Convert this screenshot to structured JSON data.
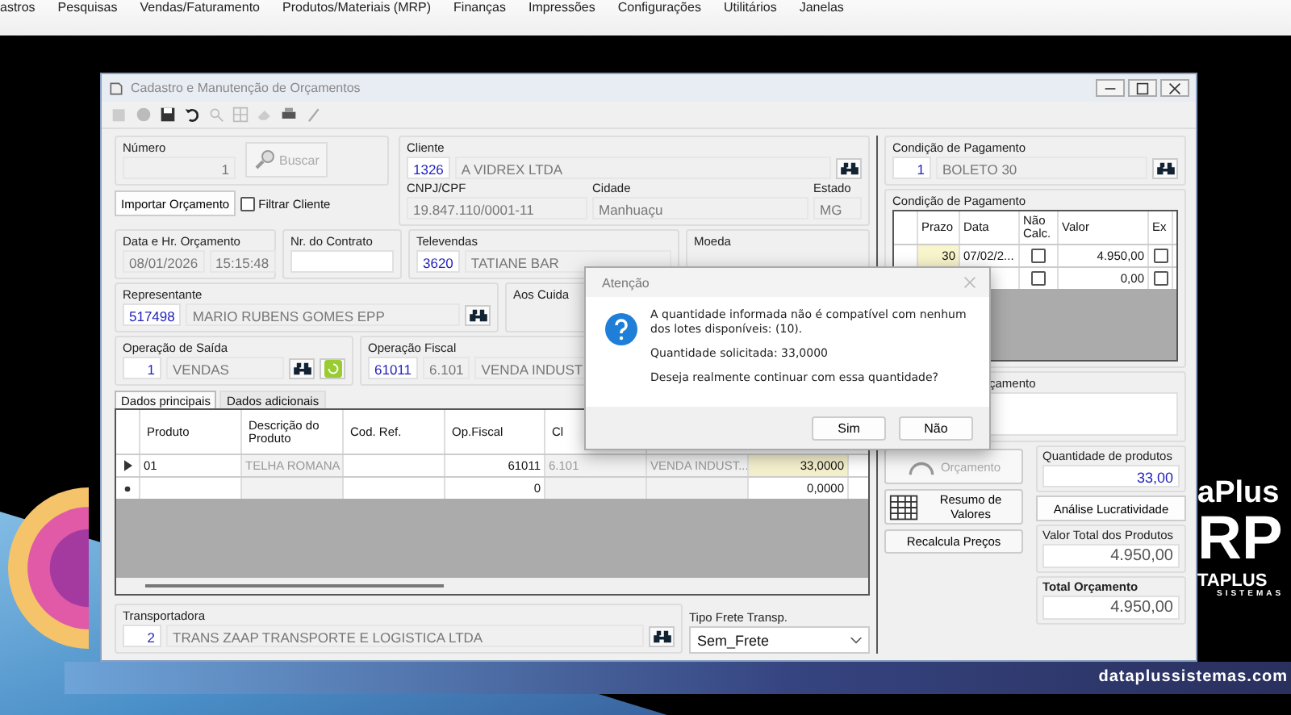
{
  "menu": [
    {
      "label": "astros"
    },
    {
      "label": "Pesquisas"
    },
    {
      "label": "Vendas/Faturamento"
    },
    {
      "label": "Produtos/Materiais (MRP)"
    },
    {
      "label": "Finanças"
    },
    {
      "label": "Impressões"
    },
    {
      "label": "Configurações"
    },
    {
      "label": "Utilitários"
    },
    {
      "label": "Janelas"
    }
  ],
  "window": {
    "title": "Cadastro e Manutenção de Orçamentos"
  },
  "numero": {
    "label": "Número",
    "value": "1",
    "search_button": "Buscar",
    "search_disabled": true
  },
  "cliente": {
    "label": "Cliente",
    "code": "1326",
    "name": "A VIDREX LTDA",
    "cnpj_label": "CNPJ/CPF",
    "cnpj": "19.847.110/0001-11",
    "cidade_label": "Cidade",
    "cidade": "Manhuaçu",
    "estado_label": "Estado",
    "estado": "MG"
  },
  "import_button": "Importar Orçamento",
  "filter_client": {
    "label": "Filtrar Cliente",
    "checked": false
  },
  "data": {
    "label": "Data e Hr. Orçamento",
    "date": "08/01/2026",
    "time": "15:15:48"
  },
  "contrato": {
    "label": "Nr. do Contrato"
  },
  "televendas": {
    "label": "Televendas",
    "code": "3620",
    "name": "TATIANE BAR"
  },
  "moeda": {
    "label": "Moeda"
  },
  "representante": {
    "label": "Representante",
    "code": "517498",
    "name": "MARIO RUBENS GOMES EPP"
  },
  "aos_cuidados": {
    "label": "Aos Cuida"
  },
  "operacao_saida": {
    "label": "Operação de Saída",
    "code": "1",
    "name": "VENDAS"
  },
  "operacao_fiscal": {
    "label": "Operação Fiscal",
    "code": "61011",
    "cfop": "6.101",
    "name": "VENDA INDUST"
  },
  "tabs": [
    {
      "label": "Dados principais",
      "selected": true
    },
    {
      "label": "Dados adicionais",
      "selected": false
    }
  ],
  "items_table": {
    "columns": [
      "Produto",
      "Descrição do Produto",
      "Cod. Ref.",
      "Op.Fiscal",
      "Cl"
    ],
    "rows": [
      {
        "kind": "current",
        "selected": true,
        "cells": [
          "01",
          "TELHA ROMANA",
          null,
          "61011",
          "6.101",
          "VENDA INDUST...",
          "33,0000"
        ]
      },
      {
        "kind": "new",
        "selected": false,
        "cells": [
          null,
          null,
          null,
          "0",
          null,
          null,
          "0,0000"
        ]
      }
    ]
  },
  "transportadora": {
    "label": "Transportadora",
    "code": "2",
    "name": "TRANS ZAAP TRANSPORTE E LOGISTICA LTDA"
  },
  "frete": {
    "label": "Tipo Frete Transp.",
    "value": "Sem_Frete"
  },
  "pay_condition": {
    "label": "Condição de Pagamento",
    "code": "1",
    "name": "BOLETO 30"
  },
  "installments": {
    "label": "Condição de Pagamento",
    "columns": [
      "Prazo",
      "Data",
      "Não Calc.",
      "Valor",
      "Ex"
    ],
    "rows": [
      {
        "prazo": "30",
        "data": "07/02/2...",
        "nao_calc": false,
        "valor": "4.950,00",
        "ex": false
      },
      {
        "nao_calc": false,
        "valor": "0,00",
        "ex": false
      }
    ]
  },
  "observacao": {
    "label": "çamento"
  },
  "actions": [
    {
      "kind": "gauge",
      "label": "Orçamento",
      "disabled": true
    },
    {
      "kind": "grid",
      "label": "Resumo de Valores",
      "disabled": false
    },
    {
      "kind": "plain",
      "label": "Recalcula Preços",
      "disabled": false
    }
  ],
  "quantidade": {
    "label": "Quantidade de produtos",
    "value": "33,00"
  },
  "analysis_button": "Análise Lucratividade",
  "valor_total": {
    "label": "Valor Total dos Produtos",
    "value": "4.950,00"
  },
  "total": {
    "label": "Total Orçamento",
    "value": "4.950,00"
  },
  "dialog": {
    "title": "Atenção",
    "message": "A quantidade informada não é compatível com nenhum dos lotes disponíveis: (10).",
    "detail": "Quantidade solicitada: 33,0000",
    "question": "Deseja realmente continuar com essa quantidade?",
    "buttons": [
      "Sim",
      "Não"
    ]
  },
  "wallpaper": {
    "brand_lines": [
      "aPlus",
      "RP",
      "TAPLUS",
      "SISTEMAS"
    ],
    "url": "dataplussistemas.com"
  }
}
